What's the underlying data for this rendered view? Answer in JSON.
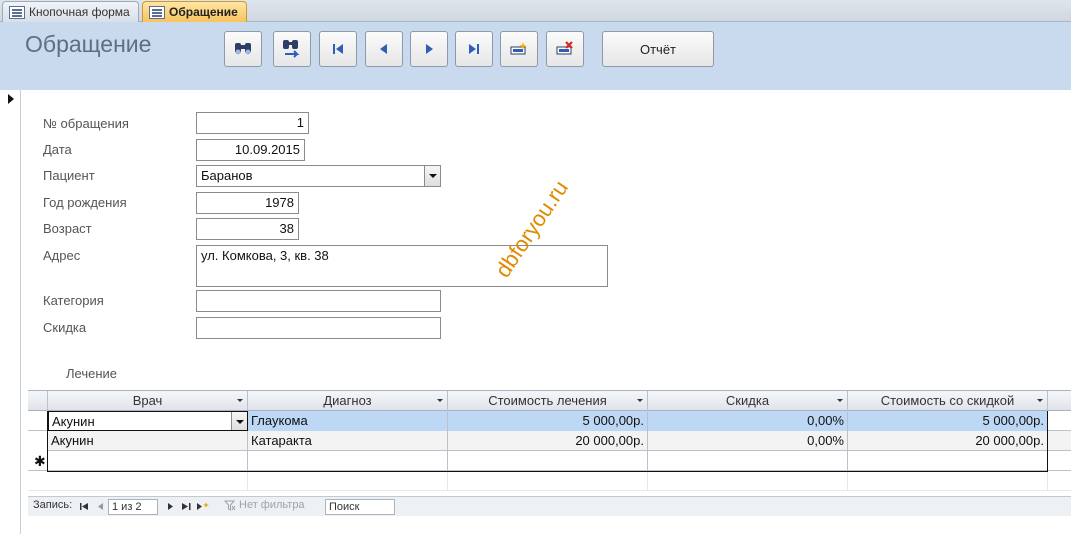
{
  "tabs": [
    {
      "label": "Кнопочная форма",
      "active": false
    },
    {
      "label": "Обращение",
      "active": true
    }
  ],
  "header": {
    "title": "Обращение",
    "report_label": "Отчёт",
    "toolbar_icons": [
      "find-icon",
      "find-next-icon",
      "first-record-icon",
      "previous-record-icon",
      "next-record-icon",
      "last-record-icon",
      "new-record-icon",
      "delete-record-icon"
    ]
  },
  "form": {
    "number": {
      "label": "№ обращения",
      "value": "1"
    },
    "date": {
      "label": "Дата",
      "value": "10.09.2015"
    },
    "patient": {
      "label": "Пациент",
      "value": "Баранов"
    },
    "birth_year": {
      "label": "Год рождения",
      "value": "1978"
    },
    "age": {
      "label": "Возраст",
      "value": "38"
    },
    "address": {
      "label": "Адрес",
      "value": "ул. Комкова, 3, кв. 38"
    },
    "category": {
      "label": "Категория",
      "value": ""
    },
    "discount": {
      "label": "Скидка",
      "value": ""
    }
  },
  "watermark": "dbforyou.ru",
  "treatment": {
    "label": "Лечение",
    "columns": [
      "Врач",
      "Диагноз",
      "Стоимость лечения",
      "Скидка",
      "Стоимость со скидкой"
    ],
    "rows": [
      [
        "Акунин",
        "Глаукома",
        "5 000,00р.",
        "0,00%",
        "5 000,00р."
      ],
      [
        "Акунин",
        "Катаракта",
        "20 000,00р.",
        "0,00%",
        "20 000,00р."
      ]
    ],
    "new_row_marker": "✱"
  },
  "navbar": {
    "record_label": "Запись:",
    "position": "1 из 2",
    "filter_label": "Нет фильтра",
    "search_placeholder": "Поиск"
  },
  "colors": {
    "header_band": "#c9d9ee",
    "active_tab": "#f7c35c",
    "current_row": "#bcd8f5",
    "watermark": "#e08a00"
  }
}
